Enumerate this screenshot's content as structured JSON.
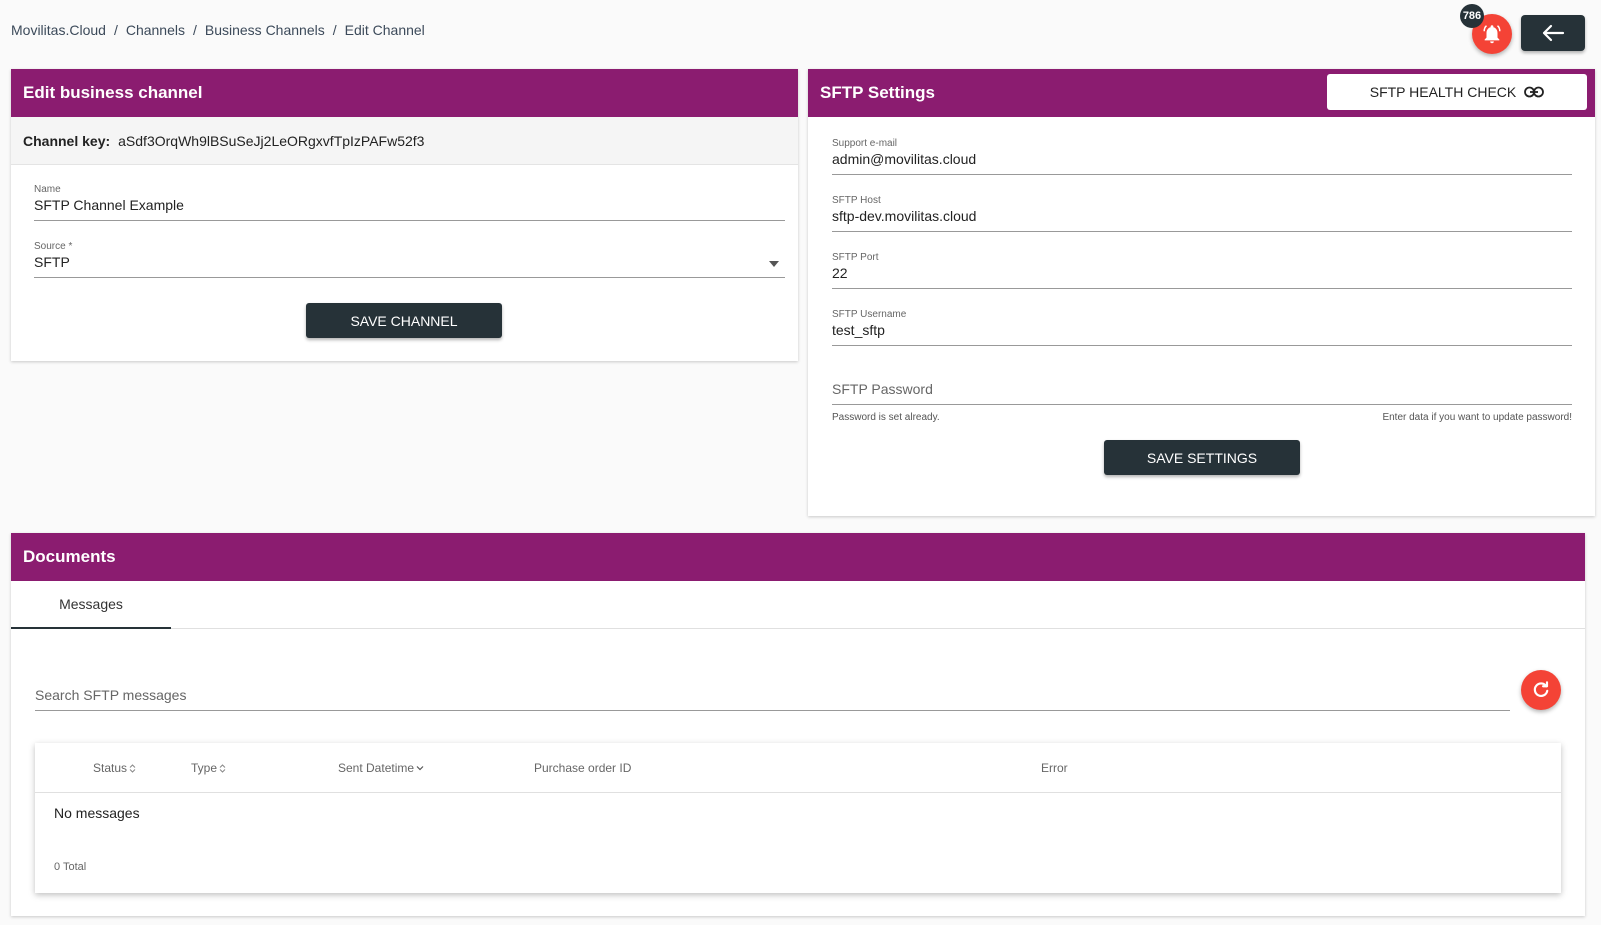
{
  "breadcrumb": {
    "items": [
      "Movilitas.Cloud",
      "Channels",
      "Business Channels",
      "Edit Channel"
    ],
    "separator": "/"
  },
  "header": {
    "notification_count": "786",
    "bell_icon": "bell-icon",
    "back_icon": "arrow-left-icon"
  },
  "edit_channel": {
    "title": "Edit business channel",
    "channel_key_label": "Channel key:",
    "channel_key_value": "aSdf3OrqWh9lBSuSeJj2LeORgxvfTpIzPAFw52f3",
    "name_label": "Name",
    "name_value": "SFTP Channel Example",
    "source_label": "Source *",
    "source_value": "SFTP",
    "save_label": "SAVE CHANNEL"
  },
  "sftp": {
    "title": "SFTP Settings",
    "health_check_label": "SFTP HEALTH CHECK",
    "support_email_label": "Support e-mail",
    "support_email_value": "admin@movilitas.cloud",
    "host_label": "SFTP Host",
    "host_value": "sftp-dev.movilitas.cloud",
    "port_label": "SFTP Port",
    "port_value": "22",
    "username_label": "SFTP Username",
    "username_value": "test_sftp",
    "password_placeholder": "SFTP Password",
    "password_hint_left": "Password is set already.",
    "password_hint_right": "Enter data if you want to update password!",
    "save_label": "SAVE SETTINGS"
  },
  "documents": {
    "title": "Documents",
    "tab_label": "Messages",
    "search_placeholder": "Search SFTP messages",
    "columns": [
      {
        "label": "Status",
        "sort": "both"
      },
      {
        "label": "Type",
        "sort": "both"
      },
      {
        "label": "Sent Datetime",
        "sort": "down"
      },
      {
        "label": "Purchase order ID",
        "sort": ""
      },
      {
        "label": "Error",
        "sort": ""
      }
    ],
    "empty_text": "No messages",
    "total_text": "0 Total"
  },
  "colors": {
    "header_bg": "#8b1c70",
    "button_dark": "#263238",
    "accent_red": "#f44336"
  }
}
